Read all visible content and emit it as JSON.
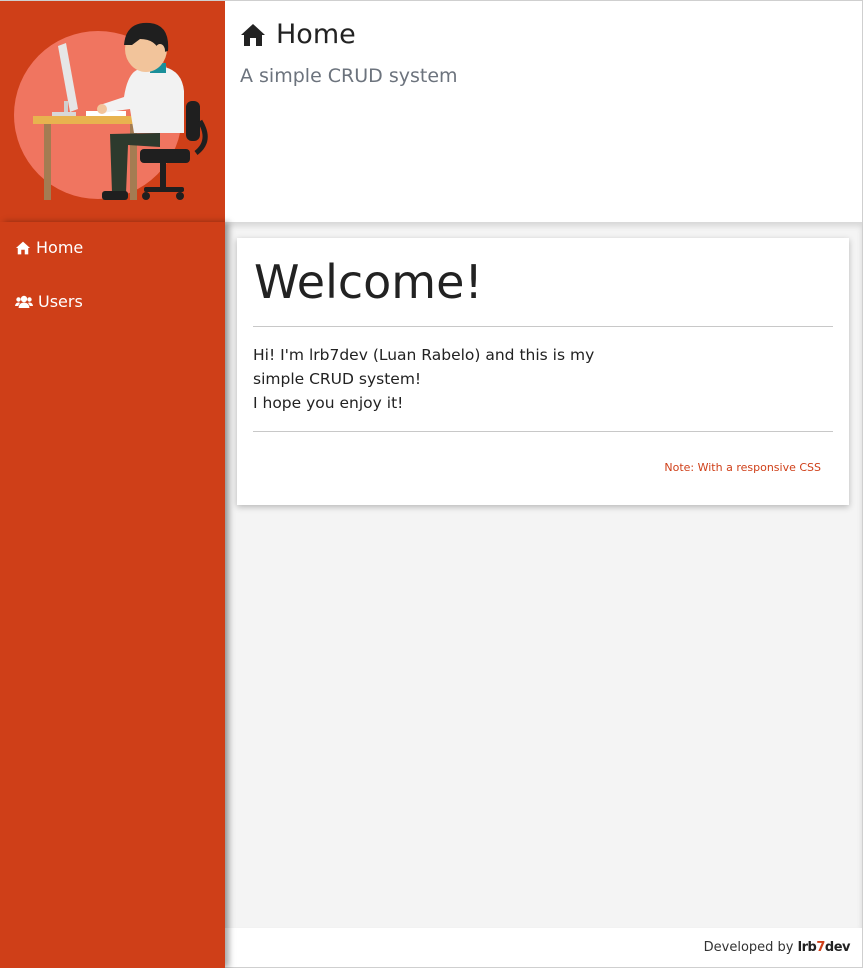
{
  "header": {
    "title": "Home",
    "subtitle": "A simple CRUD system",
    "icon": "home-icon"
  },
  "sidebar": {
    "items": [
      {
        "label": "Home",
        "icon": "home-icon"
      },
      {
        "label": "Users",
        "icon": "users-icon"
      }
    ]
  },
  "card": {
    "heading": "Welcome!",
    "lines": [
      "Hi! I'm lrb7dev (Luan Rabelo) and this is my",
      "simple CRUD system!",
      "I hope you enjoy it!"
    ],
    "note": "Note: With a responsive CSS"
  },
  "footer": {
    "prefix": "Developed by",
    "brand_a": "lrb",
    "brand_b": "7",
    "brand_c": "dev"
  },
  "colors": {
    "accent": "#cf3f18",
    "main_bg": "#f4f4f4",
    "text": "#222222",
    "subtitle": "#6c737d"
  }
}
